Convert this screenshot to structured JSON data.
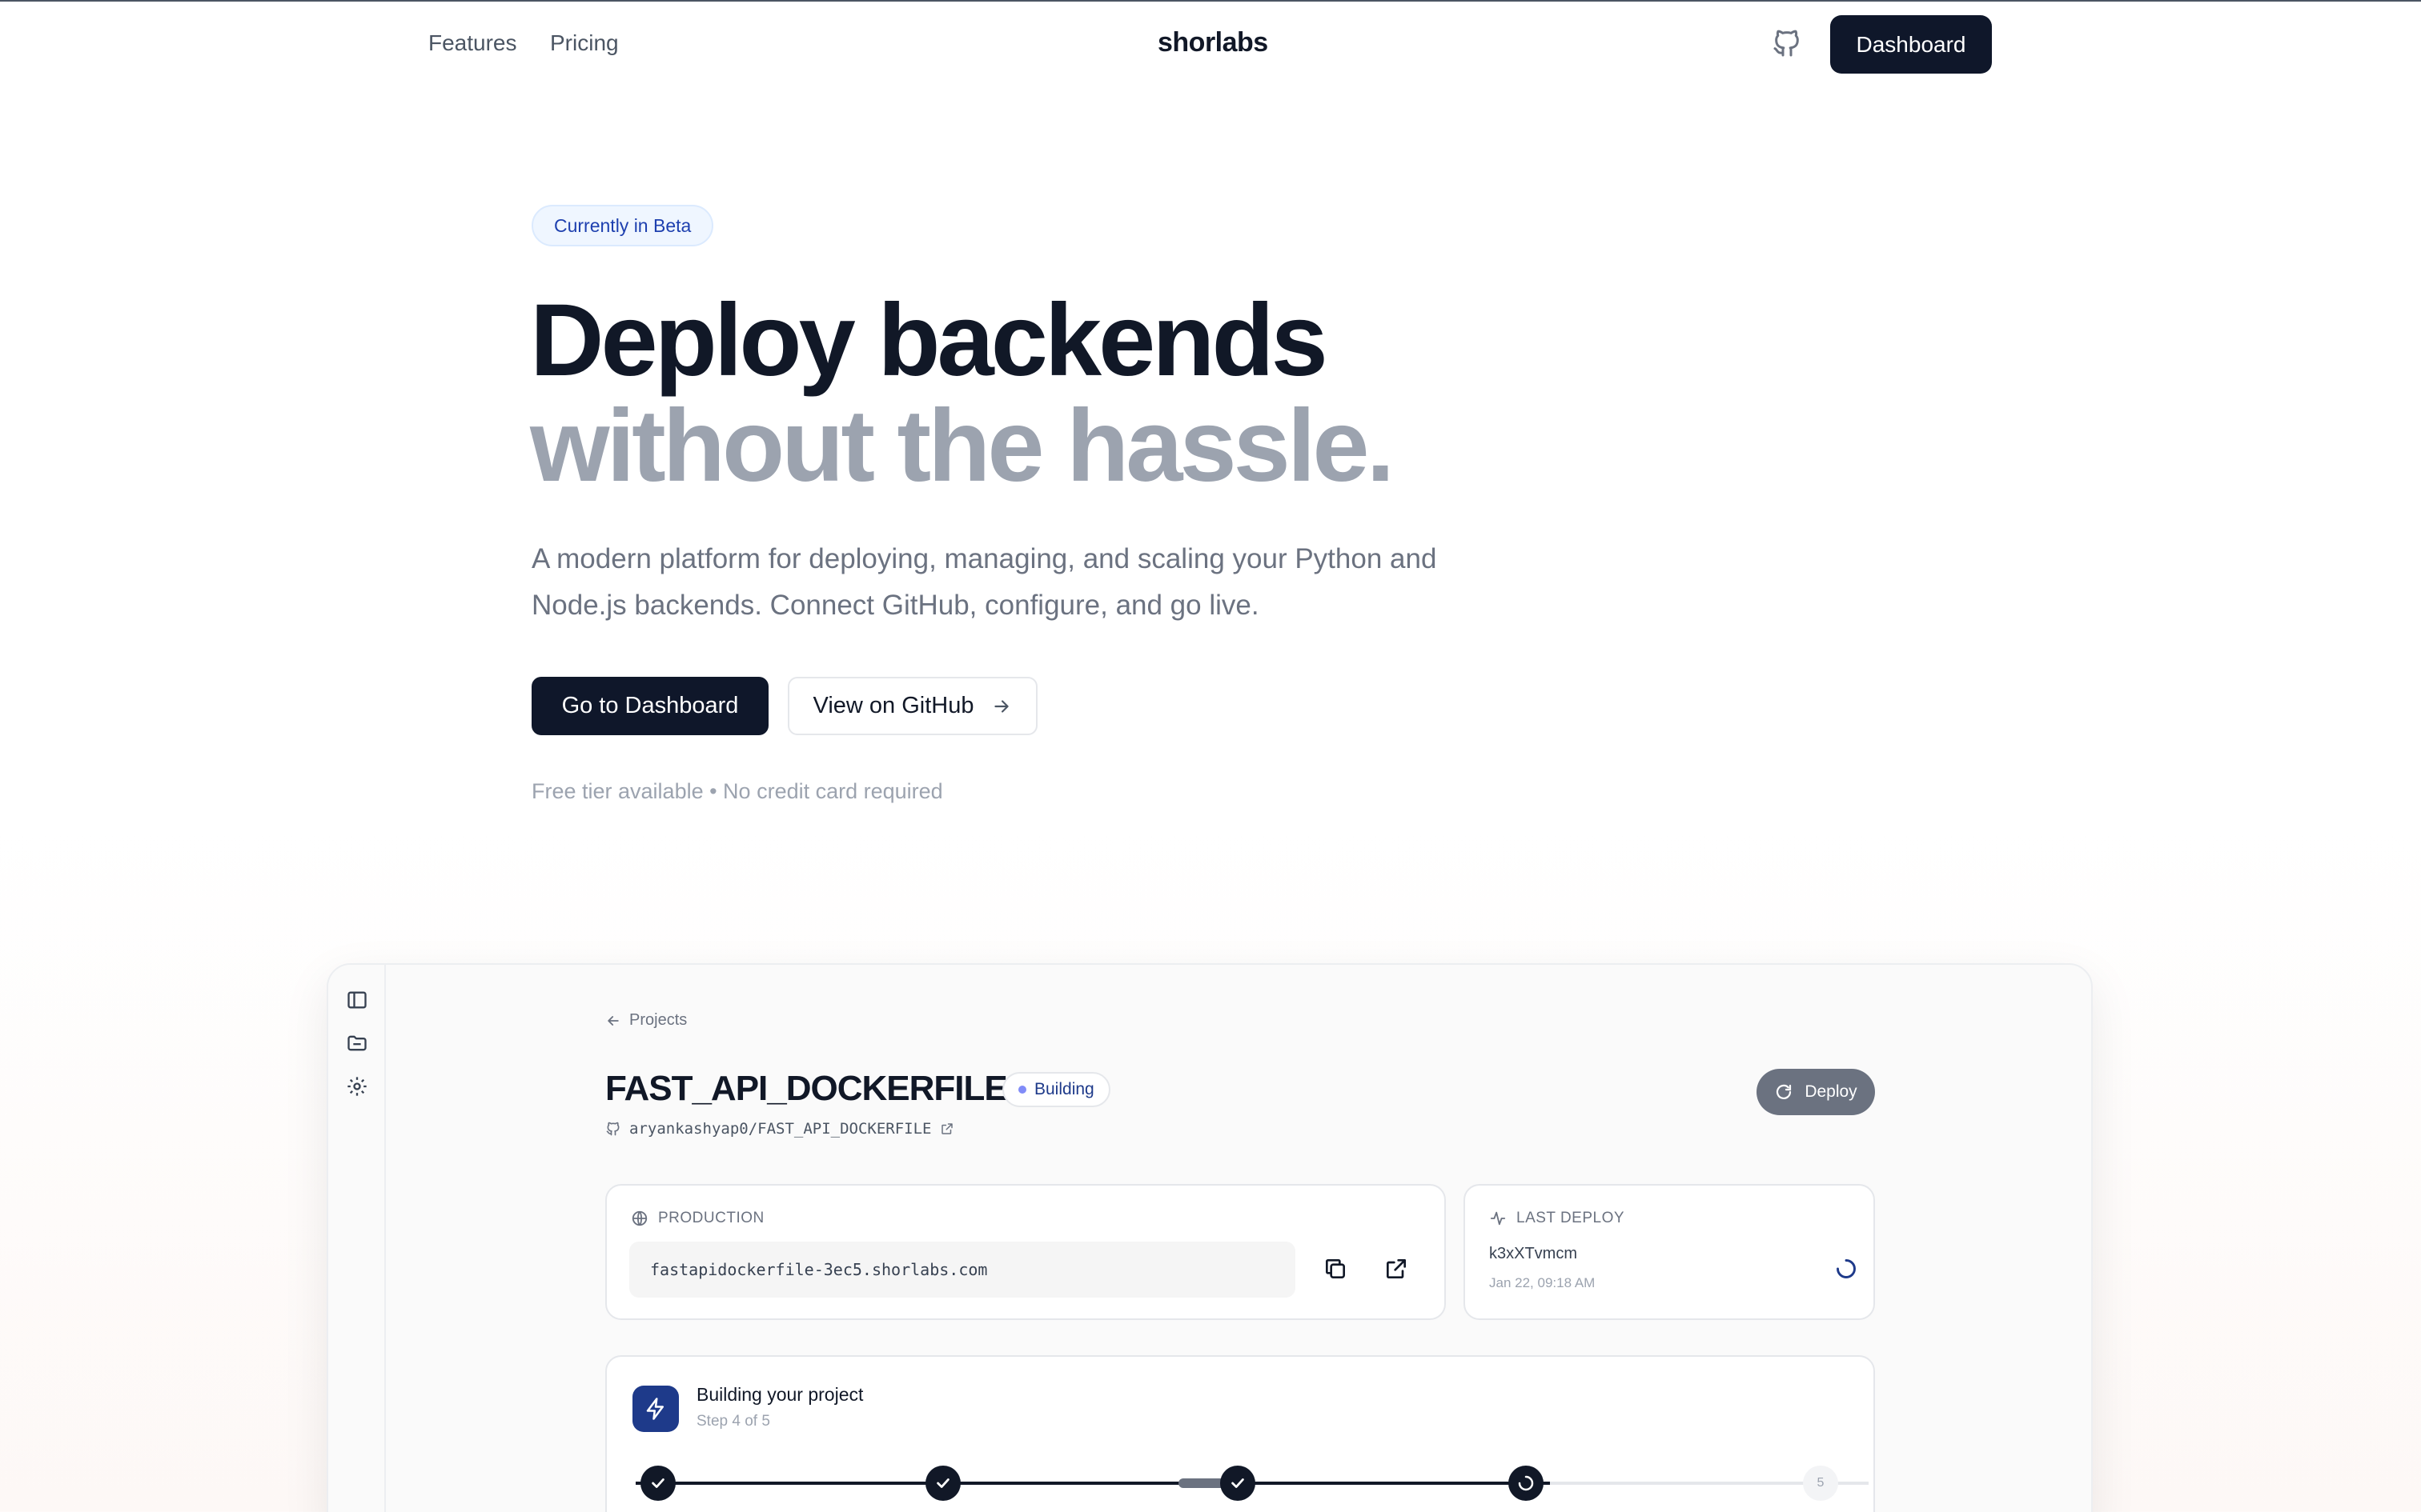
{
  "nav": {
    "links": [
      "Features",
      "Pricing"
    ],
    "brand": "shorlabs",
    "dashboard_label": "Dashboard"
  },
  "hero": {
    "badge": "Currently in Beta",
    "headline_line1": "Deploy backends",
    "headline_line2": "without the hassle.",
    "lead": "A modern platform for deploying, managing, and scaling your Python and Node.js backends. Connect GitHub, configure, and go live.",
    "primary_cta": "Go to Dashboard",
    "secondary_cta": "View on GitHub",
    "fineprint": "Free tier available • No credit card required"
  },
  "mock": {
    "breadcrumb": "Projects",
    "project_name": "FAST_API_DOCKERFILE",
    "status": "Building",
    "repo": "aryankashyap0/FAST_API_DOCKERFILE",
    "deploy_label": "Deploy",
    "production": {
      "label": "PRODUCTION",
      "url": "fastapidockerfile-3ec5.shorlabs.com"
    },
    "last_deploy": {
      "label": "LAST DEPLOY",
      "commit": "k3xXTvmcm",
      "time": "Jan 22, 09:18 AM"
    },
    "build": {
      "title": "Building your project",
      "step_text": "Step 4 of 5",
      "step5_number": "5"
    }
  },
  "colors": {
    "primary": "#0f172a",
    "accent": "#1e3a8a",
    "muted": "#9ca3af"
  }
}
